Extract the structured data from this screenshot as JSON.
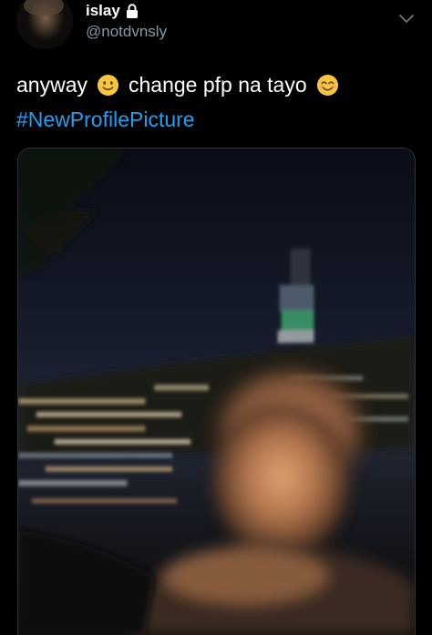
{
  "header": {
    "display_name": "islay",
    "handle": "@notdvnsly",
    "avatar_icon": "avatar",
    "protected_icon": "lock-icon",
    "menu_icon": "chevron-down-icon"
  },
  "tweet": {
    "text_part1": "anyway",
    "emoji1": "slightly-smiling-face",
    "text_part2": "change pfp na tayo",
    "emoji2": "smiling-face-with-smiling-eyes",
    "hashtag": "#NewProfilePicture"
  },
  "colors": {
    "background": "#000000",
    "text": "#ffffff",
    "secondary_text": "#8899a6",
    "link": "#1da1f2"
  }
}
